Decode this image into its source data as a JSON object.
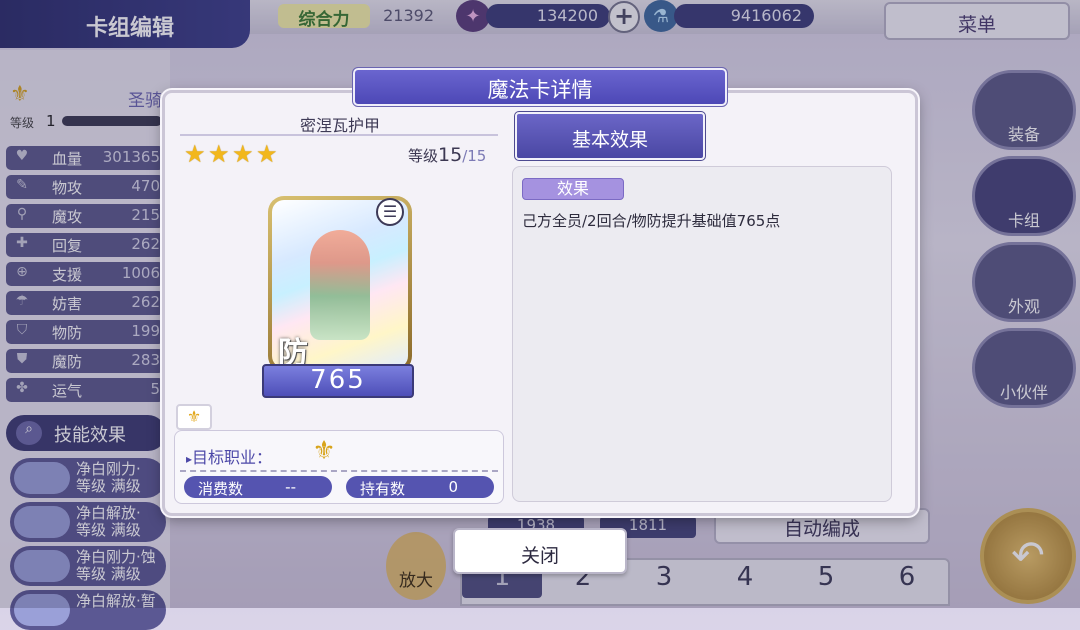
{
  "header": {
    "title": "卡组编辑",
    "power_label": "综合力",
    "power_value": "21392",
    "currency1_value": "134200",
    "currency2_value": "9416062",
    "menu_label": "菜单"
  },
  "left_panel": {
    "class_name": "圣骑",
    "level_label": "等级",
    "level_value": "1",
    "stats": [
      {
        "label": "血量",
        "value": "301365"
      },
      {
        "label": "物攻",
        "value": "470"
      },
      {
        "label": "魔攻",
        "value": "215"
      },
      {
        "label": "回复",
        "value": "262"
      },
      {
        "label": "支援",
        "value": "1006"
      },
      {
        "label": "妨害",
        "value": "262"
      },
      {
        "label": "物防",
        "value": "199"
      },
      {
        "label": "魔防",
        "value": "283"
      },
      {
        "label": "运气",
        "value": "5"
      }
    ],
    "skill_title": "技能效果",
    "skills": [
      {
        "line1": "净白刚力·",
        "line2": "等级 满级"
      },
      {
        "line1": "净白解放·",
        "line2": "等级 满级"
      },
      {
        "line1": "净白刚力·蚀",
        "line2": "等级 满级"
      },
      {
        "line1": "净白解放·暂",
        "line2": ""
      }
    ]
  },
  "right_nav": {
    "equip": "装备",
    "deck": "卡组",
    "appearance": "外观",
    "partner": "小伙伴"
  },
  "bottom": {
    "auto_label": "自动编成",
    "zoom_label": "放大",
    "stat_a": "1938",
    "stat_b": "1811",
    "pages": [
      "1",
      "2",
      "3",
      "4",
      "5",
      "6"
    ],
    "active_page": 1
  },
  "dialog": {
    "title": "魔法卡详情",
    "card_name": "密涅瓦护甲",
    "stars": 4,
    "level_label": "等级",
    "level_current": "15",
    "level_max": "/15",
    "card_type_char": "防",
    "card_value": "765",
    "target_label": "目标职业：",
    "cost_label": "消费数",
    "cost_value": "--",
    "owned_label": "持有数",
    "owned_value": "0",
    "tab_label": "基本效果",
    "effect_tag": "效果",
    "effect_text": "己方全员/2回合/物防提升基础值765点",
    "close_label": "关闭"
  },
  "icons": [
    "power-icon",
    "gem-icon",
    "potion-icon",
    "plus-icon",
    "star-icon",
    "fleur-icon",
    "menu-lines-icon",
    "back-arrow-icon",
    "magnifier-icon"
  ],
  "colors": {
    "accent": "#4d48b6",
    "star": "#f2b71c",
    "tag": "#a592e0"
  }
}
